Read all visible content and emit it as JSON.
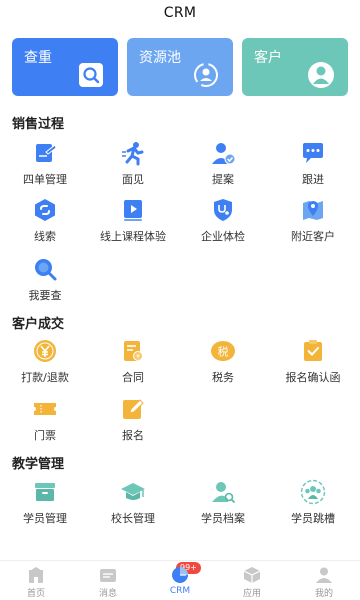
{
  "header": {
    "title": "CRM"
  },
  "cards": [
    {
      "label": "查重",
      "icon": "search-icon"
    },
    {
      "label": "资源池",
      "icon": "refresh-user-icon"
    },
    {
      "label": "客户",
      "icon": "person-icon"
    }
  ],
  "sections": {
    "sales": {
      "title": "销售过程",
      "items": [
        {
          "label": "四单管理",
          "icon": "document-icon"
        },
        {
          "label": "面见",
          "icon": "running-person-icon"
        },
        {
          "label": "提案",
          "icon": "user-check-icon"
        },
        {
          "label": "跟进",
          "icon": "chat-bubble-icon"
        },
        {
          "label": "线索",
          "icon": "link-icon"
        },
        {
          "label": "线上课程体验",
          "icon": "play-video-icon"
        },
        {
          "label": "企业体检",
          "icon": "stethoscope-icon"
        },
        {
          "label": "附近客户",
          "icon": "map-pin-icon"
        },
        {
          "label": "我要查",
          "icon": "magnifier-icon"
        }
      ]
    },
    "deal": {
      "title": "客户成交",
      "items": [
        {
          "label": "打款/退款",
          "icon": "yen-coin-icon"
        },
        {
          "label": "合同",
          "icon": "contract-icon"
        },
        {
          "label": "税务",
          "icon": "tax-icon",
          "glyph": "税"
        },
        {
          "label": "报名确认函",
          "icon": "clipboard-check-icon"
        },
        {
          "label": "门票",
          "icon": "ticket-icon"
        },
        {
          "label": "报名",
          "icon": "pencil-icon"
        }
      ]
    },
    "teaching": {
      "title": "教学管理",
      "items": [
        {
          "label": "学员管理",
          "icon": "inbox-icon"
        },
        {
          "label": "校长管理",
          "icon": "graduation-cap-icon"
        },
        {
          "label": "学员档案",
          "icon": "user-search-icon"
        },
        {
          "label": "学员跳槽",
          "icon": "group-icon"
        }
      ]
    }
  },
  "tabbar": [
    {
      "label": "首页",
      "icon": "home-icon"
    },
    {
      "label": "消息",
      "icon": "message-icon",
      "badge": "99+"
    },
    {
      "label": "CRM",
      "icon": "pie-chart-icon",
      "active": true
    },
    {
      "label": "应用",
      "icon": "box-icon"
    },
    {
      "label": "我的",
      "icon": "user-icon"
    }
  ],
  "colors": {
    "accent": "#3f7ff4",
    "teal": "#6cc7b9",
    "orange": "#f2b53a",
    "badge": "#f04a3e"
  }
}
